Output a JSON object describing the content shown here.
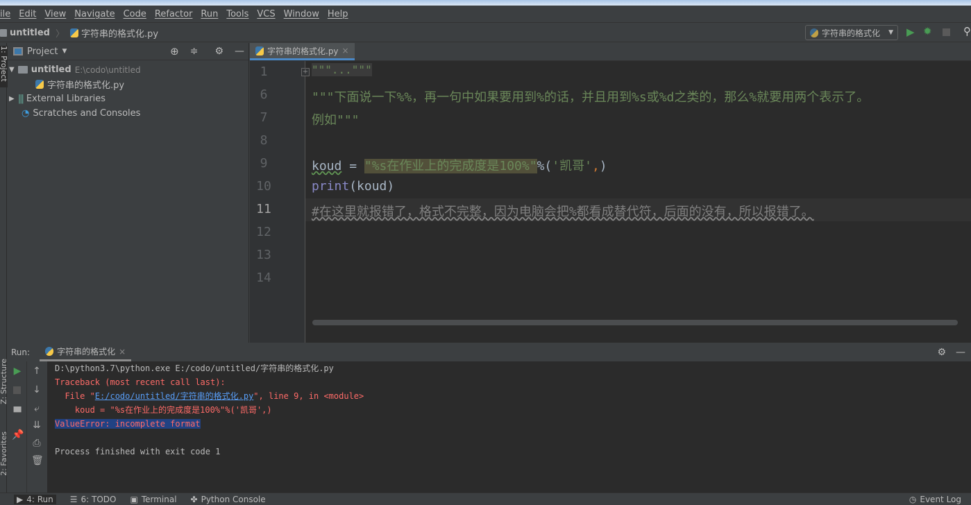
{
  "menu": [
    "ile",
    "Edit",
    "View",
    "Navigate",
    "Code",
    "Refactor",
    "Run",
    "Tools",
    "VCS",
    "Window",
    "Help"
  ],
  "breadcrumb": {
    "project": "untitled",
    "file": "字符串的格式化.py"
  },
  "run_config": "字符串的格式化",
  "project_panel": {
    "title": "Project",
    "root": "untitled",
    "root_path": "E:\\codo\\untitled",
    "file": "字符串的格式化.py",
    "external": "External Libraries",
    "scratches": "Scratches and Consoles",
    "side_label": "1: Project"
  },
  "editor": {
    "tab": "字符串的格式化.py",
    "line_numbers": [
      "1",
      "6",
      "7",
      "8",
      "9",
      "10",
      "11",
      "12",
      "13",
      "14"
    ],
    "l1": "\"\"\"...\"\"\"",
    "l6": "\"\"\"下面说一下%%，再一句中如果要用到%的话，并且用到%s或%d之类的，那么%就要用两个表示了。",
    "l7": "例如\"\"\"",
    "l9_var": "koud",
    "l9_eq": " = ",
    "l9_str": "\"%s在作业上的完成度是100%\"",
    "l9_op": "%(",
    "l9_arg": "'凯哥'",
    "l9_comma": ",",
    "l9_close": ")",
    "l10_fn": "print",
    "l10_rest": "(koud)",
    "l11": "#在这里就报错了，格式不完整，因为电脑会把%都看成替代符，后面的没有，所以报错了。"
  },
  "run": {
    "label": "Run:",
    "tab": "字符串的格式化",
    "lines": [
      "D:\\python3.7\\python.exe E:/codo/untitled/字符串的格式化.py",
      "Traceback (most recent call last):"
    ],
    "file_pre": "  File \"",
    "file_link": "E:/codo/untitled/字符串的格式化.py",
    "file_post": "\", line 9, in <module>",
    "code_line": "    koud = \"%s在作业上的完成度是100%\"%('凯哥',)",
    "error": "ValueError: incomplete format",
    "finish": "Process finished with exit code 1"
  },
  "bottom": {
    "run": "4: Run",
    "todo": "6: TODO",
    "terminal": "Terminal",
    "console": "Python Console",
    "event_log": "Event Log",
    "structure": "Z: Structure",
    "favorites": "2: Favorites"
  }
}
